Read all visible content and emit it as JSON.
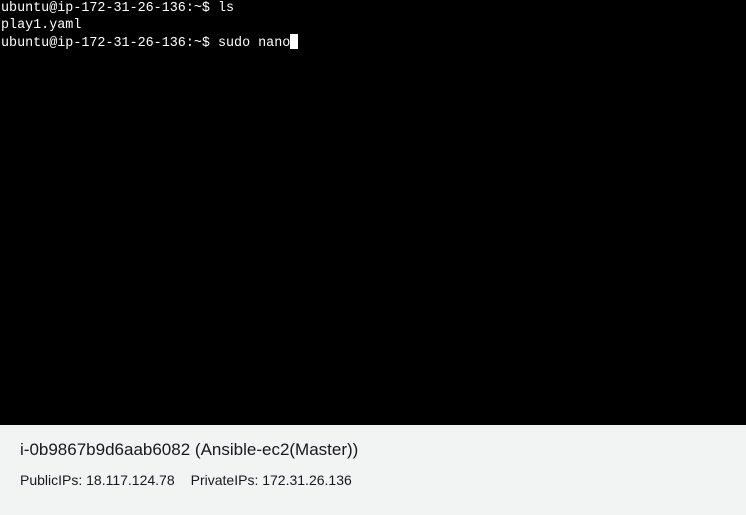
{
  "terminal": {
    "lines": [
      "ubuntu@ip-172-31-26-136:~$ ls",
      "play1.yaml",
      "ubuntu@ip-172-31-26-136:~$ sudo nano"
    ],
    "background": "#000000",
    "foreground": "#ffffff"
  },
  "instance": {
    "id": "i-0b9867b9d6aab6082",
    "name": "(Ansible-ec2(Master))",
    "public_ips_label": "PublicIPs:",
    "public_ips_value": "18.117.124.78",
    "private_ips_label": "PrivateIPs:",
    "private_ips_value": "172.31.26.136"
  },
  "colors": {
    "panel_background": "#f2f3f3",
    "panel_text": "#16191f"
  }
}
